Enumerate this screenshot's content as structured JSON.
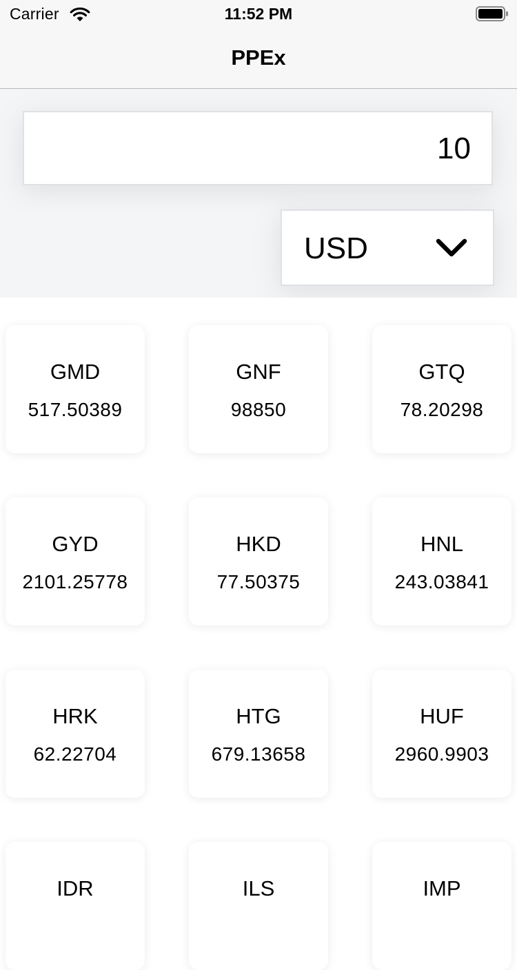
{
  "status_bar": {
    "carrier": "Carrier",
    "time": "11:52 PM",
    "wifi_icon": "wifi-icon",
    "battery_icon": "battery-icon"
  },
  "nav": {
    "title": "PPEx"
  },
  "converter": {
    "amount": "10",
    "currency": "USD",
    "dropdown_icon": "chevron-down-icon"
  },
  "rates": [
    {
      "code": "GMD",
      "value": "517.50389"
    },
    {
      "code": "GNF",
      "value": "98850"
    },
    {
      "code": "GTQ",
      "value": "78.20298"
    },
    {
      "code": "GYD",
      "value": "2101.25778"
    },
    {
      "code": "HKD",
      "value": "77.50375"
    },
    {
      "code": "HNL",
      "value": "243.03841"
    },
    {
      "code": "HRK",
      "value": "62.22704"
    },
    {
      "code": "HTG",
      "value": "679.13658"
    },
    {
      "code": "HUF",
      "value": "2960.9903"
    },
    {
      "code": "IDR",
      "value": ""
    },
    {
      "code": "ILS",
      "value": ""
    },
    {
      "code": "IMP",
      "value": ""
    }
  ]
}
